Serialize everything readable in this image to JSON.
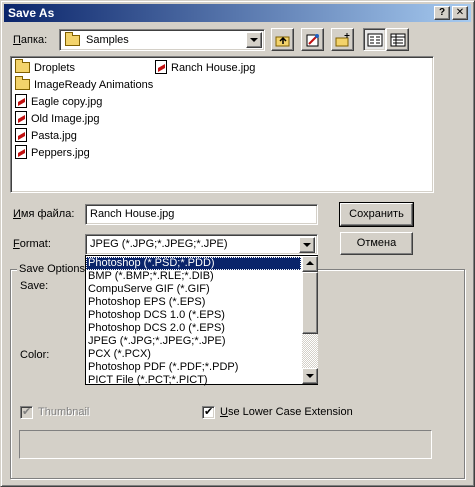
{
  "window": {
    "title": "Save As",
    "help_btn": "?",
    "close_btn": "✕"
  },
  "folder": {
    "label": "Папка:",
    "label_accel": "П",
    "label_rest": "апка:",
    "value": "Samples"
  },
  "files": [
    {
      "name": "Droplets",
      "type": "folder"
    },
    {
      "name": "ImageReady Animations",
      "type": "folder"
    },
    {
      "name": "Eagle copy.jpg",
      "type": "image"
    },
    {
      "name": "Old Image.jpg",
      "type": "image"
    },
    {
      "name": "Pasta.jpg",
      "type": "image"
    },
    {
      "name": "Peppers.jpg",
      "type": "image"
    },
    {
      "name": "Ranch House.jpg",
      "type": "image"
    }
  ],
  "filename": {
    "label_accel": "И",
    "label_rest": "мя файла:",
    "value": "Ranch House.jpg"
  },
  "format": {
    "label_accel": "F",
    "label_rest": "ormat:",
    "value": "JPEG (*.JPG;*.JPEG;*.JPE)"
  },
  "buttons": {
    "save": "Сохранить",
    "cancel": "Отмена"
  },
  "format_options": [
    "Photoshop (*.PSD;*.PDD)",
    "BMP (*.BMP;*.RLE;*.DIB)",
    "CompuServe GIF (*.GIF)",
    "Photoshop EPS (*.EPS)",
    "Photoshop DCS 1.0 (*.EPS)",
    "Photoshop DCS 2.0 (*.EPS)",
    "JPEG (*.JPG;*.JPEG;*.JPE)",
    "PCX (*.PCX)",
    "Photoshop PDF (*.PDF;*.PDP)",
    "PICT File (*.PCT;*.PICT)"
  ],
  "selected_format_index": 0,
  "save_options": {
    "group_label": "Save Options",
    "save_label": "Save:",
    "color_label": "Color:"
  },
  "thumbnail": {
    "label": "Thumbnail",
    "checked": true,
    "disabled": true
  },
  "lowercase": {
    "label_accel": "U",
    "label_rest": "se Lower Case Extension",
    "checked": true
  },
  "colors": {
    "title_start": "#0a246a",
    "title_end": "#a6caf0",
    "face": "#d4d0c8",
    "selection": "#0a246a"
  },
  "icons": {
    "up_folder": "up-one-level-icon",
    "favorites": "favorites-icon",
    "new_folder": "new-folder-icon",
    "list_view": "list-view-icon",
    "details_view": "details-view-icon"
  }
}
